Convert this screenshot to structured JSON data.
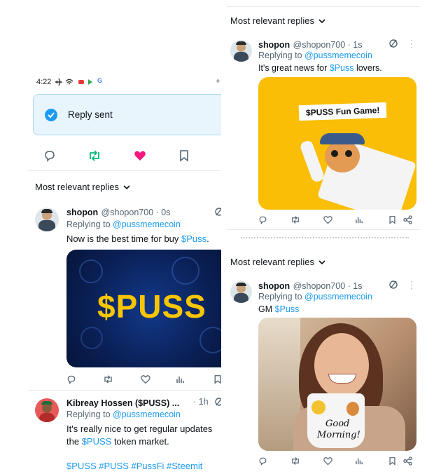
{
  "left": {
    "status_time": "4:22",
    "toast": {
      "text": "Reply sent"
    },
    "section_header": "Most relevant replies",
    "reply1": {
      "name": "shopon",
      "handle_time": "@shopon700 · 0s",
      "replying_prefix": "Replying to ",
      "replying_handle": "@pussmemecoin",
      "text_prefix": "Now is the best time for buy ",
      "text_cashtag": "$Puss",
      "text_suffix": ".",
      "media_text": "$PUSS"
    },
    "reply2": {
      "name": "Kibreay Hossen ($PUSS) ...",
      "handle_time": "· 1h",
      "replying_prefix": "Replying to ",
      "replying_handle": "@pussmemecoin",
      "line1": "It's really nice to get regular updates",
      "line2_prefix": "the ",
      "line2_cashtag": "$PUSS",
      "line2_suffix": " token market.",
      "hashtags": "$PUSS #PUSS #PussFi #Steemit"
    }
  },
  "right_top": {
    "section_header": "Most relevant replies",
    "name": "shopon",
    "handle_time": "@shopon700 · 1s",
    "replying_prefix": "Replying to ",
    "replying_handle": "@pussmemecoin",
    "text_prefix": "It's great news for ",
    "text_cashtag": "$Puss",
    "text_suffix": " lovers.",
    "media_caption": "$PUSS Fun Game!"
  },
  "right_bottom": {
    "section_header": "Most relevant replies",
    "name": "shopon",
    "handle_time": "@shopon700 · 1s",
    "replying_prefix": "Replying to ",
    "replying_handle": "@pussmemecoin",
    "text_prefix": "GM ",
    "text_cashtag": "$Puss",
    "mug_line1": "Good",
    "mug_line2": "Morning!"
  },
  "colors": {
    "accent_blue": "#1d9bf0",
    "retweet_green": "#00ba7c",
    "like_pink": "#f91880",
    "puss_yellow": "#f7c600",
    "toast_bg": "#e8f5fd"
  }
}
